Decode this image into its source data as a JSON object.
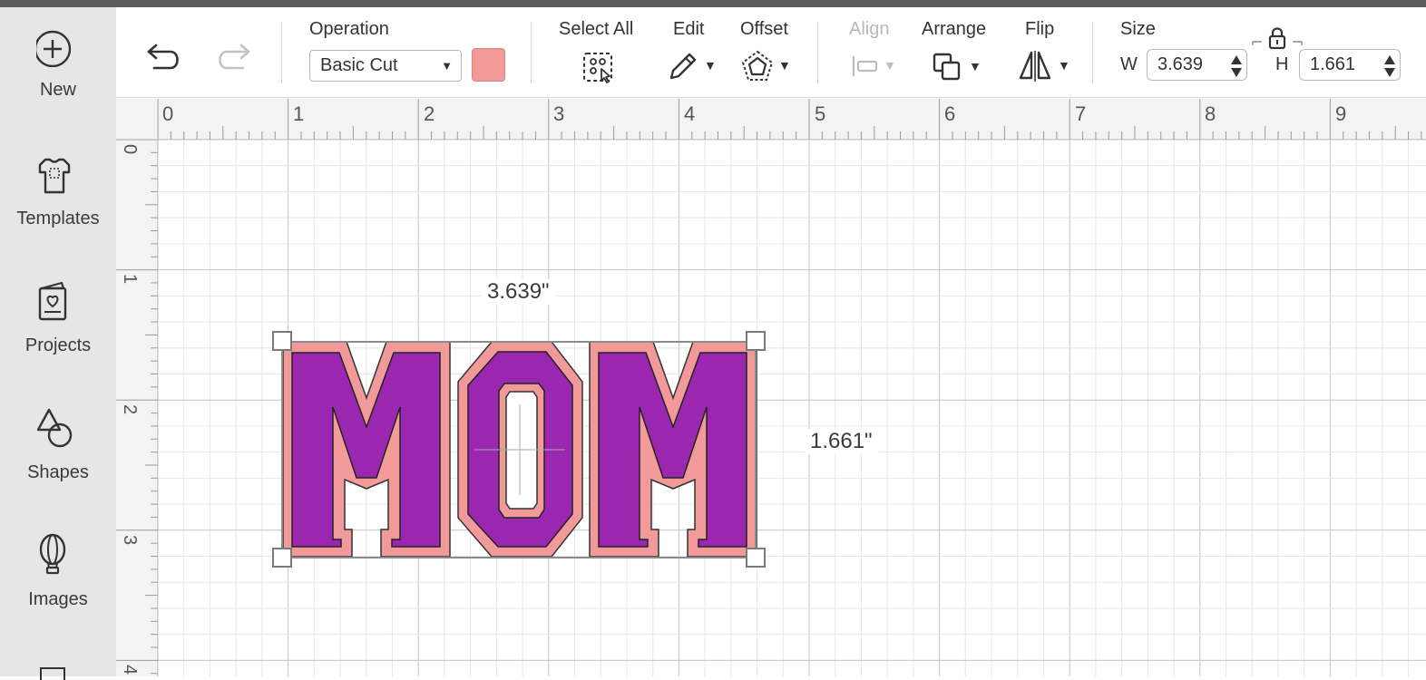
{
  "sidebar": {
    "items": [
      {
        "label": "New",
        "icon": "plus-circle-icon"
      },
      {
        "label": "Templates",
        "icon": "tshirt-icon"
      },
      {
        "label": "Projects",
        "icon": "projects-icon"
      },
      {
        "label": "Shapes",
        "icon": "shapes-icon"
      },
      {
        "label": "Images",
        "icon": "balloon-icon"
      }
    ]
  },
  "toolbar": {
    "operation_label": "Operation",
    "operation_value": "Basic Cut",
    "swatch_color": "#f29a9a",
    "select_all_label": "Select All",
    "edit_label": "Edit",
    "offset_label": "Offset",
    "align_label": "Align",
    "arrange_label": "Arrange",
    "flip_label": "Flip",
    "size_label": "Size",
    "w_label": "W",
    "w_value": "3.639",
    "h_label": "H",
    "h_value": "1.661"
  },
  "rulers": {
    "horizontal": [
      "0",
      "1",
      "2",
      "3",
      "4",
      "5",
      "6",
      "7",
      "8",
      "9"
    ],
    "vertical": [
      "0",
      "1",
      "2",
      "3",
      "4"
    ]
  },
  "selection": {
    "width_label": "3.639\"",
    "height_label": "1.661\"",
    "text": "MOM",
    "fill_color": "#9b27b0",
    "outline_color": "#f29a9a"
  }
}
